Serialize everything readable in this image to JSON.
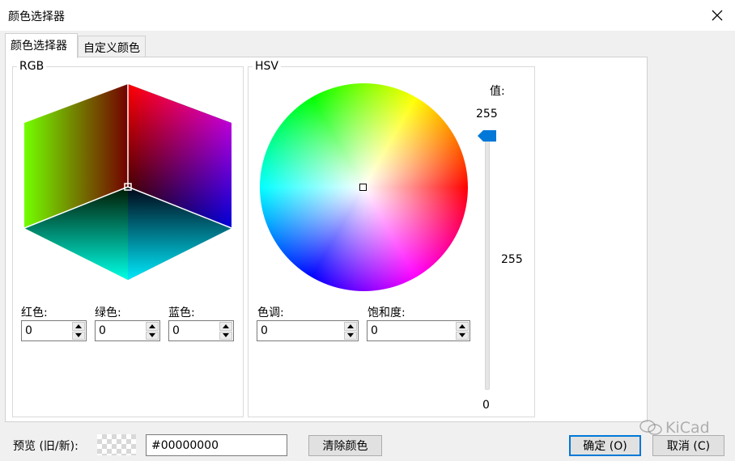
{
  "window": {
    "title": "颜色选择器"
  },
  "tabs": [
    {
      "label": "颜色选择器",
      "active": true
    },
    {
      "label": "自定义颜色",
      "active": false
    }
  ],
  "rgb": {
    "label": "RGB",
    "fields": [
      {
        "label": "红色:",
        "value": "0"
      },
      {
        "label": "绿色:",
        "value": "0"
      },
      {
        "label": "蓝色:",
        "value": "0"
      }
    ]
  },
  "hsv": {
    "label": "HSV",
    "fields": [
      {
        "label": "色调:",
        "value": "0"
      },
      {
        "label": "饱和度:",
        "value": "0"
      }
    ]
  },
  "value_slider": {
    "label": "值:",
    "max_text": "255",
    "current_text": "255",
    "min_text": "0",
    "level_fraction": 1.0
  },
  "bottom": {
    "preview_label": "预览 (旧/新):",
    "hex_value": "#00000000",
    "clear_label": "清除颜色",
    "ok_label": "确定 (O)",
    "cancel_label": "取消 (C)"
  },
  "watermark": {
    "text": "KiCad",
    "icon": "wechat-icon"
  },
  "colors": {
    "accent": "#0078d7",
    "panel_bg": "#ffffff",
    "dialog_bg": "#f0f0f0"
  }
}
